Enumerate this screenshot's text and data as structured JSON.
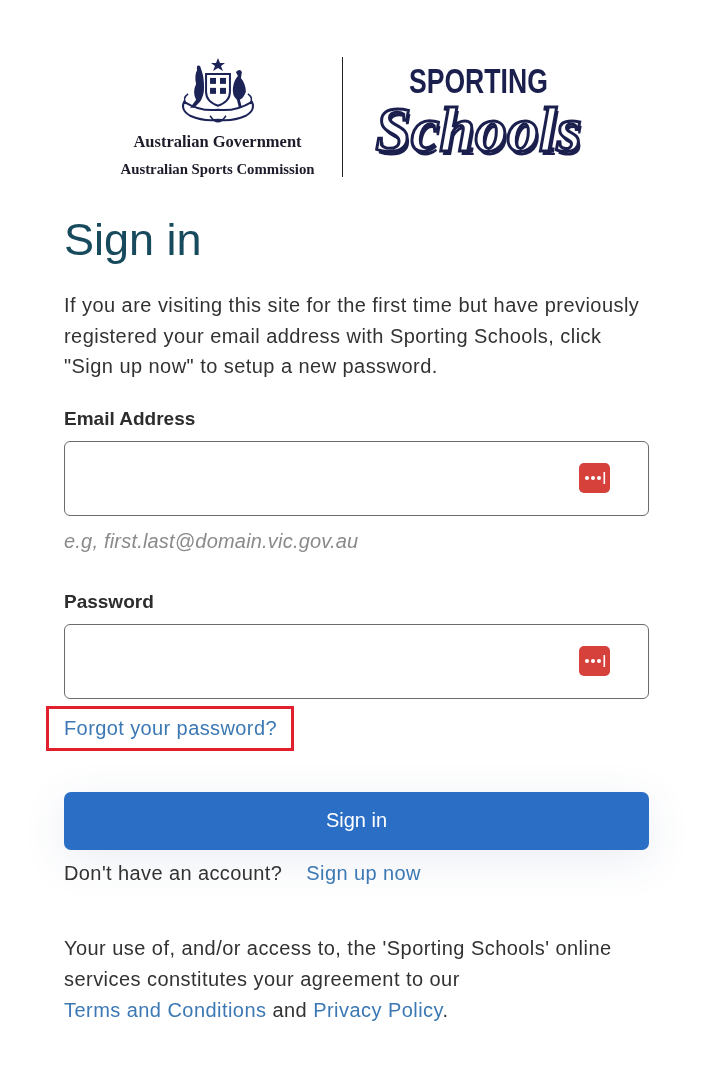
{
  "header": {
    "org_lines": [
      "Australian Government",
      "Australian Sports Commission"
    ],
    "brand": {
      "top": "SPORTING",
      "script": "Schools"
    }
  },
  "title": "Sign in",
  "intro": "If you are visiting this site for the first time but have previously registered your email address with Sporting Schools, click \"Sign up now\" to setup a new password.",
  "fields": [
    {
      "label": "Email Address",
      "hint": "e.g, first.last@domain.vic.gov.au"
    },
    {
      "label": "Password"
    }
  ],
  "forgot_link": {
    "label": "Forgot your password?",
    "highlighted": true
  },
  "submit_button": "Sign in",
  "signup": {
    "prompt": "Don't have an account?",
    "link": "Sign up now"
  },
  "legal": {
    "segments": [
      {
        "kind": "text",
        "text": "Your use of, and/or access to, the 'Sporting Schools' online services constitutes your agreement to our "
      },
      {
        "kind": "link",
        "text": "Terms and Conditions"
      },
      {
        "kind": "text",
        "text": " and "
      },
      {
        "kind": "link",
        "text": "Privacy Policy"
      },
      {
        "kind": "text",
        "text": "."
      }
    ]
  }
}
